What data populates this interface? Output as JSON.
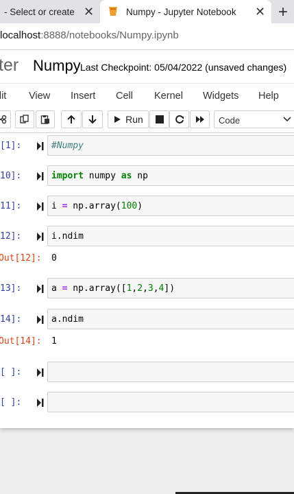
{
  "browser": {
    "tabs": [
      {
        "title": "- Select or create a n"
      },
      {
        "title": "Numpy - Jupyter Notebook"
      }
    ],
    "url_host": "localhost",
    "url_path": ":8888/notebooks/Numpy.ipynb"
  },
  "header": {
    "logo_text": "ter",
    "notebook_name": "Numpy",
    "checkpoint": "Last Checkpoint: 05/04/2022  (unsaved changes)"
  },
  "menus": [
    "dit",
    "View",
    "Insert",
    "Cell",
    "Kernel",
    "Widgets",
    "Help"
  ],
  "toolbar": {
    "run_label": "Run",
    "cell_type": "Code"
  },
  "cells": [
    {
      "prompt": "[1]:",
      "code_parts": [
        "#Numpy"
      ]
    },
    {
      "prompt": "10]:",
      "code_parts": [
        "import",
        " numpy ",
        "as",
        " np"
      ]
    },
    {
      "prompt": "11]:",
      "code_parts": [
        "i ",
        "=",
        " np.array(",
        "100",
        ")"
      ]
    },
    {
      "prompt": "12]:",
      "code_parts": [
        "i.ndim"
      ],
      "out_prompt": "Out[12]:",
      "output": "0"
    },
    {
      "prompt": "13]:",
      "code_parts": [
        "a ",
        "=",
        " np.array([",
        "1",
        ",",
        "2",
        ",",
        "3",
        ",",
        "4",
        "])"
      ]
    },
    {
      "prompt": "14]:",
      "code_parts": [
        "a.ndim"
      ],
      "out_prompt": "Out[14]:",
      "output": "1"
    },
    {
      "prompt": "[ ]:",
      "code_parts": []
    },
    {
      "prompt": "[ ]:",
      "code_parts": []
    }
  ],
  "colors": {
    "prompt_in": "#303f9f",
    "prompt_out": "#d84315",
    "keyword": "#008000",
    "comment": "#408080"
  }
}
